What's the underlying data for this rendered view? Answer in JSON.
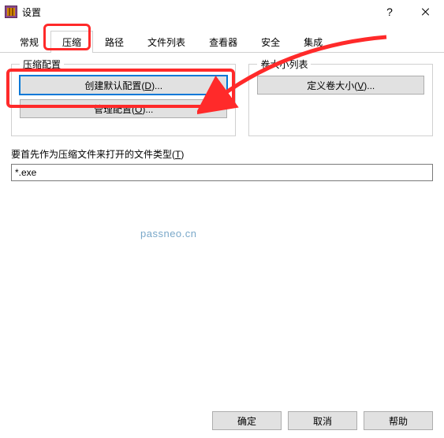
{
  "window": {
    "title": "设置"
  },
  "tabs": {
    "items": [
      "常规",
      "压缩",
      "路径",
      "文件列表",
      "查看器",
      "安全",
      "集成"
    ],
    "active_index": 1
  },
  "groups": {
    "compress": {
      "legend": "压缩配置",
      "buttons": {
        "create_default": {
          "pre": "创建默认配置(",
          "key": "D",
          "post": ")..."
        },
        "manage": {
          "pre": "管理配置(",
          "key": "O",
          "post": ")..."
        }
      }
    },
    "volumes": {
      "legend": "卷大小列表",
      "buttons": {
        "define_size": {
          "pre": "定义卷大小(",
          "key": "V",
          "post": ")..."
        }
      }
    }
  },
  "filetype_field": {
    "label_pre": "要首先作为压缩文件来打开的文件类型(",
    "label_key": "T",
    "label_post": ")",
    "value": "*.exe"
  },
  "footer": {
    "ok": "确定",
    "cancel": "取消",
    "help": "帮助"
  },
  "watermark": "passneo.cn"
}
